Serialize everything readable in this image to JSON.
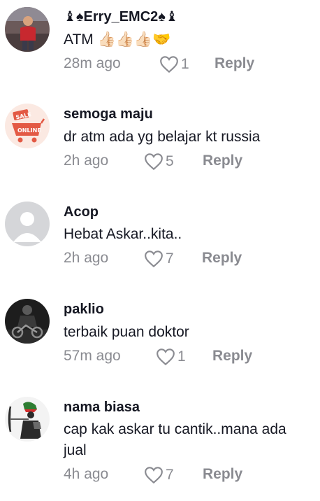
{
  "comments": [
    {
      "username": "♝♠Erry_EMC2♠♝",
      "text": "ATM 👍🏻👍🏻👍🏻🤝",
      "time": "28m ago",
      "likes": "1",
      "reply": "Reply",
      "avatar": "person-photo-avatar"
    },
    {
      "username": "semoga maju",
      "text": "dr atm ada yg belajar kt russia",
      "time": "2h ago",
      "likes": "5",
      "reply": "Reply",
      "avatar": "sale-online-cart-avatar"
    },
    {
      "username": "Acop",
      "text": "Hebat Askar..kita..",
      "time": "2h ago",
      "likes": "7",
      "reply": "Reply",
      "avatar": "default-avatar"
    },
    {
      "username": "paklio",
      "text": "terbaik puan doktor",
      "time": "57m ago",
      "likes": "1",
      "reply": "Reply",
      "avatar": "motorcycle-rider-avatar"
    },
    {
      "username": "nama biasa",
      "text": "cap kak askar tu cantik..mana ada jual",
      "time": "4h ago",
      "likes": "7",
      "reply": "Reply",
      "avatar": "archer-with-flag-avatar"
    }
  ],
  "avatar_labels": {
    "sale_badge": "SALE",
    "online_banner": "ONLINE"
  },
  "colors": {
    "text": "#161823",
    "muted": "#8a8b91",
    "background": "#ffffff"
  }
}
